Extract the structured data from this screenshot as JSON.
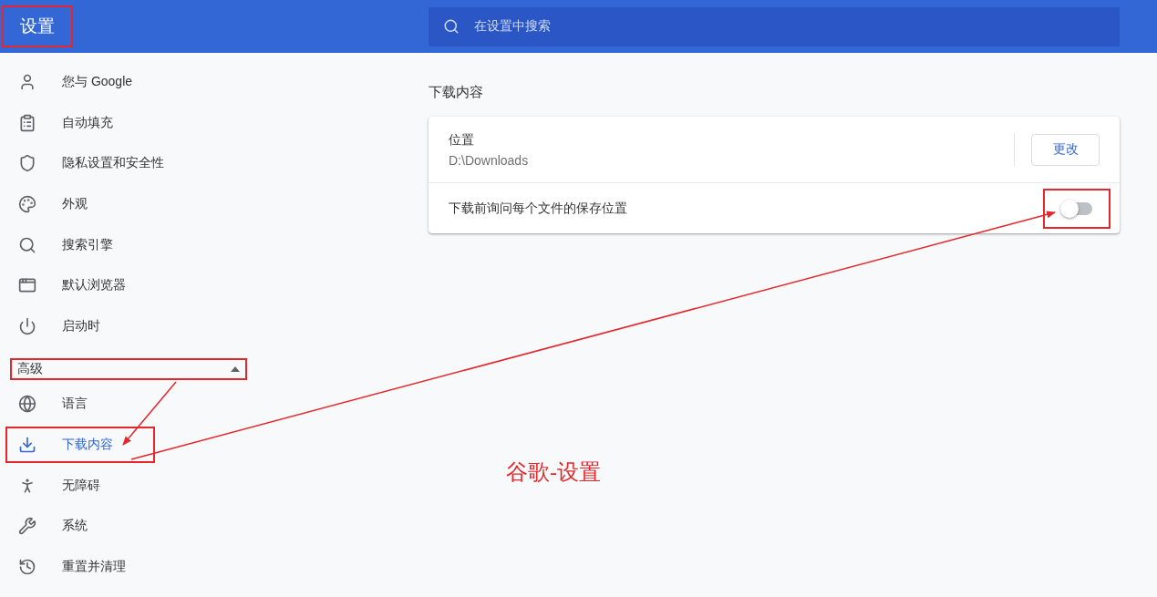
{
  "header": {
    "title": "设置",
    "title_highlighted": true,
    "search": {
      "placeholder": "在设置中搜索"
    }
  },
  "sidebar": {
    "items": [
      {
        "label": "您与 Google",
        "selected": false,
        "highlighted": false
      },
      {
        "label": "自动填充",
        "selected": false,
        "highlighted": false
      },
      {
        "label": "隐私设置和安全性",
        "selected": false,
        "highlighted": false
      },
      {
        "label": "外观",
        "selected": false,
        "highlighted": false
      },
      {
        "label": "搜索引擎",
        "selected": false,
        "highlighted": false
      },
      {
        "label": "默认浏览器",
        "selected": false,
        "highlighted": false
      },
      {
        "label": "启动时",
        "selected": false,
        "highlighted": false
      }
    ],
    "advanced": {
      "label": "高级",
      "expanded": true,
      "highlighted": true
    },
    "advanced_items": [
      {
        "label": "语言",
        "selected": false,
        "highlighted": false
      },
      {
        "label": "下载内容",
        "selected": true,
        "highlighted": true
      },
      {
        "label": "无障碍",
        "selected": false,
        "highlighted": false
      },
      {
        "label": "系统",
        "selected": false,
        "highlighted": false
      },
      {
        "label": "重置并清理",
        "selected": false,
        "highlighted": false
      }
    ]
  },
  "section": {
    "title": "下载内容",
    "location": {
      "label": "位置",
      "value": "D:\\Downloads",
      "button": "更改"
    },
    "ask_toggle": {
      "label": "下载前询问每个文件的保存位置",
      "on": false,
      "highlighted": true
    }
  },
  "annotation": {
    "caption": "谷歌-设置"
  }
}
